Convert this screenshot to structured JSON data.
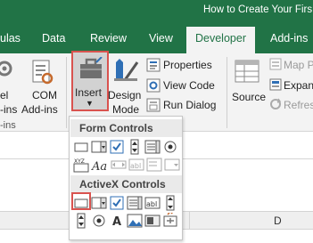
{
  "window": {
    "title": "How to Create Your Firs"
  },
  "tabs": [
    {
      "label": "ulas"
    },
    {
      "label": "Data"
    },
    {
      "label": "Review"
    },
    {
      "label": "View"
    },
    {
      "label": "Developer",
      "active": true
    },
    {
      "label": "Add-ins"
    }
  ],
  "ribbon": {
    "addins_partial_line1": "el",
    "addins_partial_line2": "-ins",
    "group_label_partial": "-ins",
    "com_addins_line1": "COM",
    "com_addins_line2": "Add-ins",
    "insert_label": "Insert",
    "design_mode_line1": "Design",
    "design_mode_line2": "Mode",
    "properties_label": "Properties",
    "view_code_label": "View Code",
    "run_dialog_label": "Run Dialog",
    "source_label": "Source",
    "map_properties_label": "Map P",
    "expansion_packs_label": "Expan",
    "refresh_data_label": "Refres"
  },
  "dropdown": {
    "form_controls_header": "Form Controls",
    "activex_controls_header": "ActiveX Controls"
  },
  "sheet": {
    "column_d": "D"
  },
  "colors": {
    "excel_green": "#217346",
    "highlight_red": "#d9534f",
    "ribbon_bg": "#f3f3f3"
  }
}
